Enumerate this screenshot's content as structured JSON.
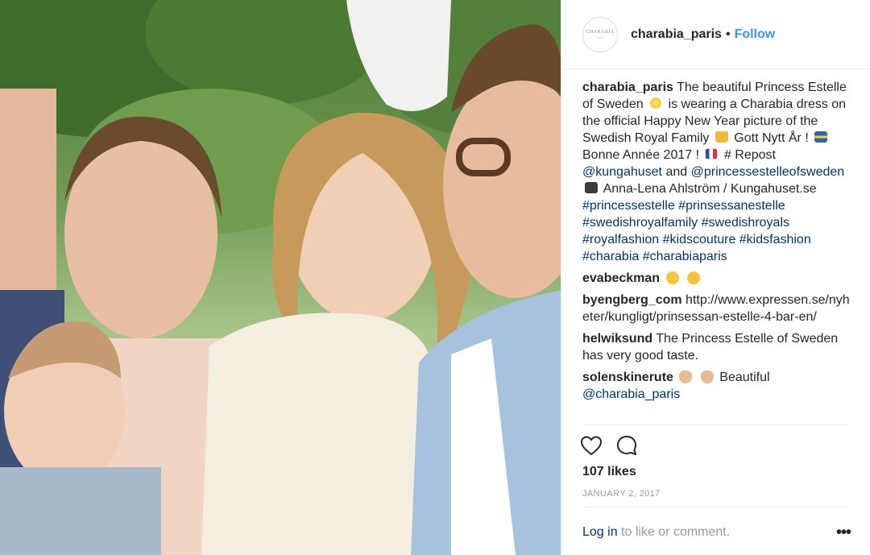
{
  "photo": {
    "description_icon": "photo-image"
  },
  "header": {
    "avatar_text": "CHARABIA",
    "avatar_sub": "PARIS",
    "username": "charabia_paris",
    "separator": "•",
    "follow_label": "Follow"
  },
  "caption": {
    "username": "charabia_paris",
    "text_1": "The beautiful Princess Estelle of Sweden",
    "text_2": "is wearing a Charabia dress on the official Happy New Year picture of the Swedish Royal Family",
    "text_3": "Gott Nytt År !",
    "text_4": "Bonne Année 2017 !",
    "text_5": "# Repost",
    "mention_1": "@kungahuset",
    "text_6": "and",
    "mention_2": "@princessestelleofsweden",
    "text_7": "Anna-Lena Ahlström / Kungahuset.se",
    "hashtags": "#princessestelle #prinsessanestelle #swedishroyalfamily #swedishroyals #royalfashion #kidscouture #kidsfashion #charabia #charabiaparis"
  },
  "comments": [
    {
      "user": "evabeckman",
      "text": ""
    },
    {
      "user": "byengberg_com",
      "text": "http://www.expressen.se/nyheter/kungligt/prinsessan-estelle-4-bar-en/"
    },
    {
      "user": "helwiksund",
      "text": "The Princess Estelle of Sweden has very good taste."
    },
    {
      "user": "solenskinerute",
      "text": "Beautiful",
      "mention": "@charabia_paris"
    }
  ],
  "footer": {
    "likes": "107 likes",
    "date": "JANUARY 2, 2017",
    "login_link": "Log in",
    "login_rest": " to like or comment.",
    "more": "•••"
  },
  "colors": {
    "link": "#003569",
    "follow": "#3897f0",
    "muted": "#999999",
    "text": "#262626"
  }
}
